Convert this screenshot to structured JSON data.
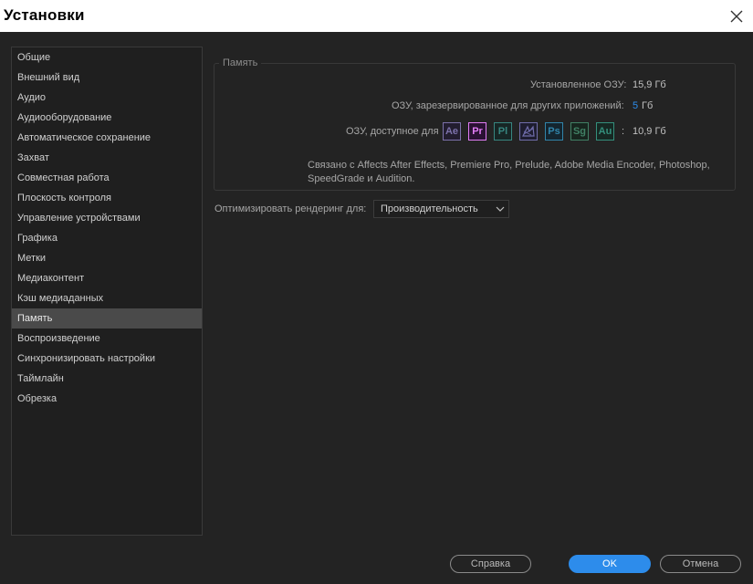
{
  "window": {
    "title": "Установки"
  },
  "sidebar": {
    "items": [
      {
        "label": "Общие"
      },
      {
        "label": "Внешний вид"
      },
      {
        "label": "Аудио"
      },
      {
        "label": "Аудиооборудование"
      },
      {
        "label": "Автоматическое сохранение"
      },
      {
        "label": "Захват"
      },
      {
        "label": "Совместная работа"
      },
      {
        "label": "Плоскость контроля"
      },
      {
        "label": "Управление устройствами"
      },
      {
        "label": "Графика"
      },
      {
        "label": "Метки"
      },
      {
        "label": "Медиаконтент"
      },
      {
        "label": "Кэш медиаданных"
      },
      {
        "label": "Память",
        "selected": true
      },
      {
        "label": "Воспроизведение"
      },
      {
        "label": "Синхронизировать настройки"
      },
      {
        "label": "Таймлайн"
      },
      {
        "label": "Обрезка"
      }
    ]
  },
  "memory": {
    "group_title": "Память",
    "installed_label": "Установленное ОЗУ:",
    "installed_value": "15,9 Гб",
    "reserved_label": "ОЗУ, зарезервированное для других приложений:",
    "reserved_value": "5",
    "reserved_unit": "Гб",
    "available_label": "ОЗУ, доступное для",
    "available_separator": ":",
    "available_value": "10,9 Гб",
    "apps": [
      {
        "abbr": "Ae",
        "color": "#9a8cd8",
        "bg": "#221c33",
        "active": false,
        "icon": "after-effects-icon"
      },
      {
        "abbr": "Pr",
        "color": "#e07cf3",
        "bg": "#2a1133",
        "active": true,
        "icon": "premiere-pro-icon"
      },
      {
        "abbr": "Pl",
        "color": "#3ea7a0",
        "bg": "#142826",
        "active": false,
        "icon": "prelude-icon"
      },
      {
        "abbr": "",
        "color": "#8a86d9",
        "bg": "#1d1b33",
        "active": false,
        "icon": "media-encoder-icon"
      },
      {
        "abbr": "Ps",
        "color": "#36a5d8",
        "bg": "#0f2633",
        "active": false,
        "icon": "photoshop-icon"
      },
      {
        "abbr": "Sg",
        "color": "#4aa07a",
        "bg": "#13261d",
        "active": false,
        "icon": "speedgrade-icon"
      },
      {
        "abbr": "Au",
        "color": "#3ab39a",
        "bg": "#122a24",
        "active": false,
        "icon": "audition-icon"
      }
    ],
    "linked_text": "Связано с Affects After Effects, Premiere Pro, Prelude, Adobe Media Encoder, Photoshop, SpeedGrade и Audition."
  },
  "optimize": {
    "label": "Оптимизировать рендеринг для:",
    "selected": "Производительность"
  },
  "buttons": {
    "help": "Справка",
    "ok": "OK",
    "cancel": "Отмена"
  },
  "colors": {
    "accent": "#2d8ceb",
    "background": "#232323",
    "sidebar_selected": "#4a4a4a"
  }
}
